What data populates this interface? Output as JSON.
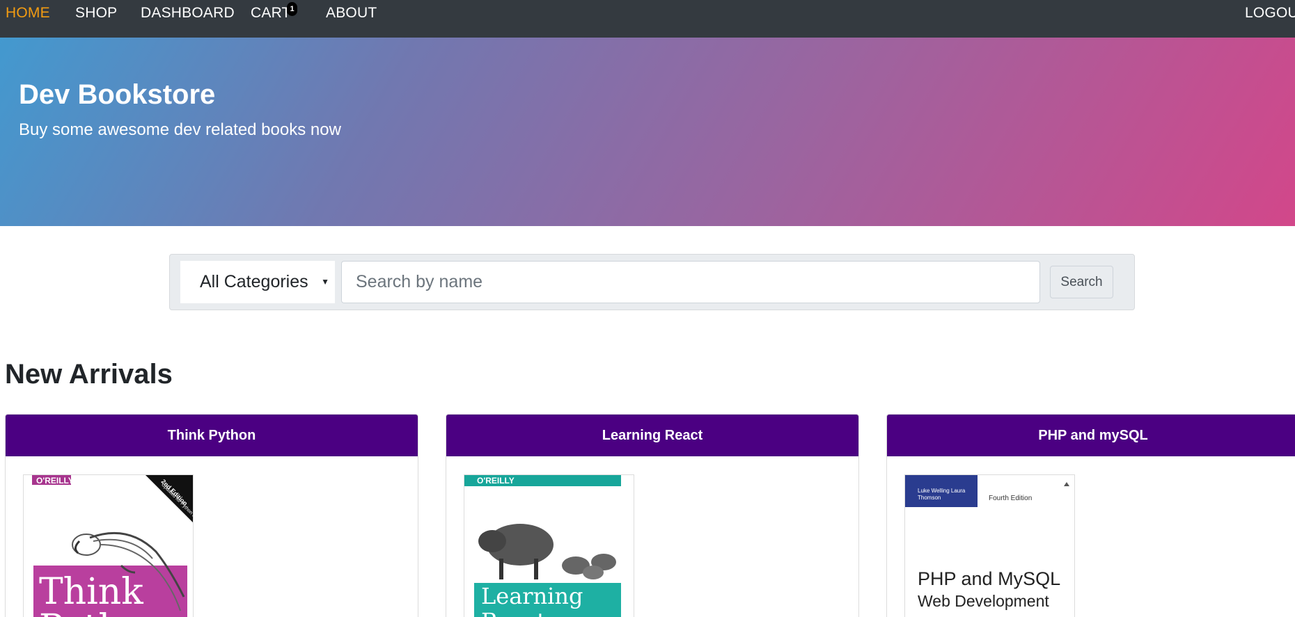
{
  "nav": {
    "home": "HOME",
    "shop": "SHOP",
    "dashboard": "DASHBOARD",
    "cart": "CART",
    "cart_count": "1",
    "about": "ABOUT",
    "logout": "LOGOUT"
  },
  "hero": {
    "title": "Dev Bookstore",
    "subtitle": "Buy some awesome dev related books now"
  },
  "search": {
    "category_selected": "All Categories",
    "placeholder": "Search by name",
    "button_label": "Search"
  },
  "section": {
    "title": "New Arrivals"
  },
  "books": [
    {
      "title": "Think Python",
      "publisher": "O'REILLY",
      "edition": "2nd Edition",
      "edition_note": "Updated for Python 3",
      "cover_text": "Think Python"
    },
    {
      "title": "Learning React",
      "publisher": "O'REILLY",
      "cover_text": "Learning React"
    },
    {
      "title": "PHP and mySQL",
      "authors": "Luke Welling Laura Thomson",
      "edition": "Fourth Edition",
      "cover_text_line1": "PHP and MySQL",
      "cover_text_line2": "Web Development"
    }
  ],
  "colors": {
    "navbar": "#343a40",
    "nav_active": "#f39c12",
    "card_header": "#4b0082",
    "hero_gradient_start": "#4399cf",
    "hero_gradient_end": "#d2478a"
  }
}
